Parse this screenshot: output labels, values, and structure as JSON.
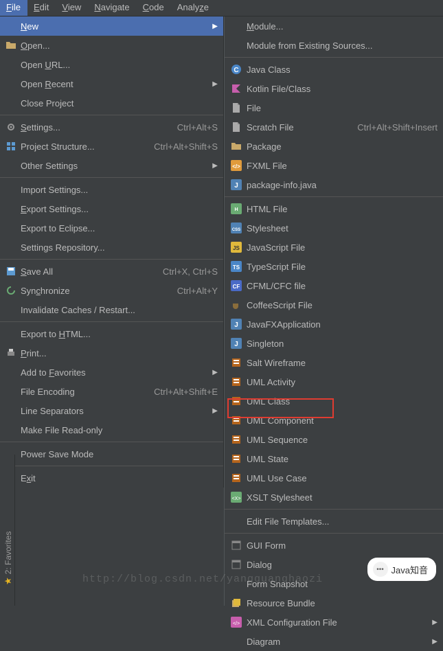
{
  "menubar": [
    {
      "label": "File",
      "mn": "F",
      "active": true
    },
    {
      "label": "Edit",
      "mn": "E"
    },
    {
      "label": "View",
      "mn": "V"
    },
    {
      "label": "Navigate",
      "mn": "N"
    },
    {
      "label": "Code",
      "mn": "C"
    },
    {
      "label": "Analyze",
      "mn": "z"
    }
  ],
  "fileMenu": [
    {
      "label": "New",
      "mn": "N",
      "arrow": true,
      "selected": true,
      "icon": ""
    },
    {
      "label": "Open...",
      "mn": "O",
      "icon": "folder"
    },
    {
      "label": "Open URL...",
      "mn": "U"
    },
    {
      "label": "Open Recent",
      "mn": "R",
      "arrow": true
    },
    {
      "label": "Close Project"
    },
    {
      "sep": true
    },
    {
      "label": "Settings...",
      "mn": "S",
      "shortcut": "Ctrl+Alt+S",
      "icon": "gear"
    },
    {
      "label": "Project Structure...",
      "shortcut": "Ctrl+Alt+Shift+S",
      "icon": "struct"
    },
    {
      "label": "Other Settings",
      "arrow": true
    },
    {
      "sep": true
    },
    {
      "label": "Import Settings..."
    },
    {
      "label": "Export Settings...",
      "mn": "E"
    },
    {
      "label": "Export to Eclipse..."
    },
    {
      "label": "Settings Repository..."
    },
    {
      "sep": true
    },
    {
      "label": "Save All",
      "mn": "S",
      "shortcut": "Ctrl+X, Ctrl+S",
      "icon": "save"
    },
    {
      "label": "Synchronize",
      "mn": "c",
      "shortcut": "Ctrl+Alt+Y",
      "icon": "sync"
    },
    {
      "label": "Invalidate Caches / Restart..."
    },
    {
      "sep": true
    },
    {
      "label": "Export to HTML...",
      "mn": "H"
    },
    {
      "label": "Print...",
      "mn": "P",
      "icon": "print"
    },
    {
      "label": "Add to Favorites",
      "mn": "F",
      "arrow": true
    },
    {
      "label": "File Encoding",
      "shortcut": "Ctrl+Alt+Shift+E"
    },
    {
      "label": "Line Separators",
      "arrow": true
    },
    {
      "label": "Make File Read-only"
    },
    {
      "sep": true
    },
    {
      "label": "Power Save Mode"
    },
    {
      "sep": true
    },
    {
      "label": "Exit",
      "mn": "x"
    }
  ],
  "newMenu": [
    {
      "label": "Module...",
      "mn": "M"
    },
    {
      "label": "Module from Existing Sources..."
    },
    {
      "sep": true
    },
    {
      "label": "Java Class",
      "icon": "class"
    },
    {
      "label": "Kotlin File/Class",
      "icon": "kotlin"
    },
    {
      "label": "File",
      "icon": "file"
    },
    {
      "label": "Scratch File",
      "shortcut": "Ctrl+Alt+Shift+Insert",
      "icon": "file"
    },
    {
      "label": "Package",
      "icon": "folder"
    },
    {
      "label": "FXML File",
      "icon": "fxml"
    },
    {
      "label": "package-info.java",
      "icon": "java"
    },
    {
      "sep": true
    },
    {
      "label": "HTML File",
      "icon": "html"
    },
    {
      "label": "Stylesheet",
      "icon": "css"
    },
    {
      "label": "JavaScript File",
      "icon": "js"
    },
    {
      "label": "TypeScript File",
      "icon": "ts"
    },
    {
      "label": "CFML/CFC file",
      "icon": "cf"
    },
    {
      "label": "CoffeeScript File",
      "icon": "coffee"
    },
    {
      "label": "JavaFXApplication",
      "icon": "java"
    },
    {
      "label": "Singleton",
      "icon": "java"
    },
    {
      "label": "Salt Wireframe",
      "icon": "uml"
    },
    {
      "label": "UML Activity",
      "icon": "uml"
    },
    {
      "label": "UML Class",
      "icon": "uml"
    },
    {
      "label": "UML Component",
      "icon": "uml"
    },
    {
      "label": "UML Sequence",
      "icon": "uml",
      "highlight": true
    },
    {
      "label": "UML State",
      "icon": "uml"
    },
    {
      "label": "UML Use Case",
      "icon": "uml"
    },
    {
      "label": "XSLT Stylesheet",
      "icon": "xsl"
    },
    {
      "sep": true
    },
    {
      "label": "Edit File Templates..."
    },
    {
      "sep": true
    },
    {
      "label": "GUI Form",
      "icon": "form"
    },
    {
      "label": "Dialog",
      "icon": "form"
    },
    {
      "label": "Form Snapshot"
    },
    {
      "label": "Resource Bundle",
      "icon": "bundle"
    },
    {
      "label": "XML Configuration File",
      "icon": "xml",
      "arrow": true
    },
    {
      "label": "Diagram",
      "arrow": true
    }
  ],
  "sidebar": {
    "label": "2: Favorites"
  },
  "watermark": "http://blog.csdn.net/yangguanghaozi",
  "bubble": "Java知音"
}
